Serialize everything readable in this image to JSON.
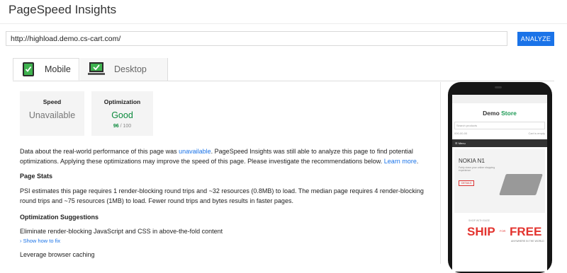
{
  "app": {
    "title": "PageSpeed Insights"
  },
  "url_bar": {
    "value": "http://highload.demo.cs-cart.com/",
    "analyze_label": "ANALYZE"
  },
  "tabs": [
    {
      "label": "Mobile",
      "icon": "mobile-check-icon",
      "active": true
    },
    {
      "label": "Desktop",
      "icon": "desktop-check-icon",
      "active": false
    }
  ],
  "summary": {
    "speed": {
      "label": "Speed",
      "value": "Unavailable"
    },
    "optimization": {
      "label": "Optimization",
      "value": "Good",
      "score": "96",
      "max": "/ 100"
    }
  },
  "intro": {
    "text_before": "Data about the real-world performance of this page was ",
    "link1": "unavailable",
    "text_after": ". PageSpeed Insights was still able to analyze this page to find potential optimizations. Applying these optimizations may improve the speed of this page. Please investigate the recommendations below. ",
    "link2": "Learn more"
  },
  "page_stats": {
    "heading": "Page Stats",
    "text": "PSI estimates this page requires 1 render-blocking round trips and ~32 resources (0.8MB) to load. The median page requires 4 render-blocking round trips and ~75 resources (1MB) to load. Fewer round trips and bytes results in faster pages."
  },
  "suggestions": {
    "heading": "Optimization Suggestions",
    "item1": "Eliminate render-blocking JavaScript and CSS in above-the-fold content",
    "show_fix": "› Show how to fix",
    "item2": "Leverage browser caching"
  },
  "preview": {
    "logo_a": "Demo ",
    "logo_b": "Store",
    "search": "Search products",
    "phone_row": "000-00-00",
    "cart": "Cart is empty",
    "menu": "☰ Menu",
    "banner_title": "NOKIA N1",
    "banner_desc": "Fairly down your online shopping experience",
    "banner_btn": "DETAILS",
    "ship_small": "SHOP WITH EASE",
    "ship_big": "SHIP",
    "ship_for": "FOR",
    "ship_big2": "FREE",
    "ship_world": "ANYWHERE IN THE WORLD"
  }
}
